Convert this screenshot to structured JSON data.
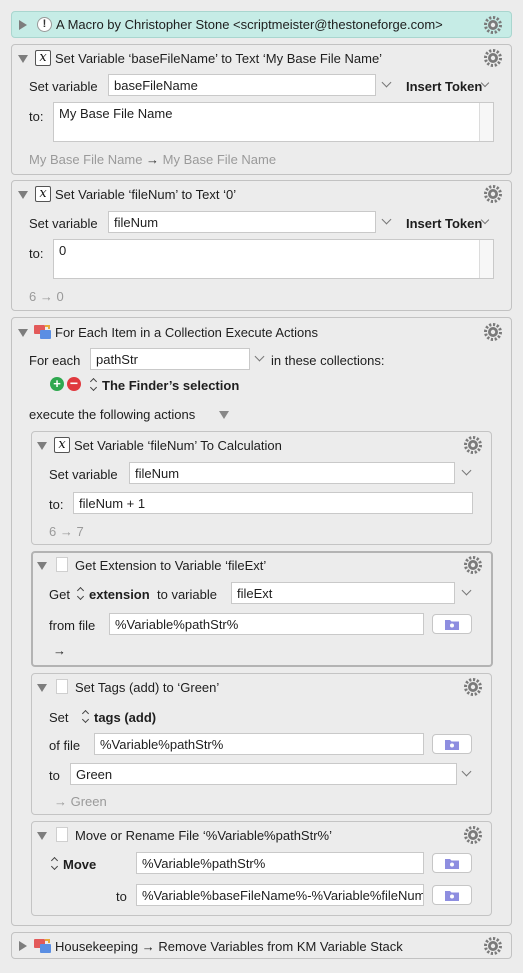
{
  "macro_header": {
    "title": "A Macro by Christopher Stone <scriptmeister@thestoneforge.com>",
    "bg": "#c6ece6"
  },
  "action1": {
    "title": "Set Variable ‘baseFileName’ to Text ‘My Base File Name’",
    "set_variable_label": "Set variable",
    "variable": "baseFileName",
    "insert_token": "Insert Token",
    "to_label": "to:",
    "value": "My Base File Name",
    "preview_left": "My Base File Name",
    "preview_arrow": "→",
    "preview_right": "My Base File Name"
  },
  "action2": {
    "title": "Set Variable ‘fileNum’ to Text ‘0’",
    "set_variable_label": "Set variable",
    "variable": "fileNum",
    "insert_token": "Insert Token",
    "to_label": "to:",
    "value": "0",
    "preview": "6 → 0"
  },
  "foreach": {
    "title": "For Each Item in a Collection Execute Actions",
    "for_each_label": "For each",
    "variable": "pathStr",
    "in_collections_label": "in these collections:",
    "collection": "The Finder’s selection",
    "execute_label": "execute the following actions",
    "sub1": {
      "title": "Set Variable ‘fileNum’ To Calculation",
      "set_variable_label": "Set variable",
      "variable": "fileNum",
      "to_label": "to:",
      "value": "fileNum + 1",
      "preview": "6 → 7"
    },
    "sub2": {
      "title": "Get Extension to Variable ‘fileExt’",
      "get_label": "Get",
      "what": "extension",
      "to_variable_label": "to variable",
      "variable": "fileExt",
      "from_file_label": "from file",
      "file": "%Variable%pathStr%",
      "preview": "→"
    },
    "sub3": {
      "title": "Set Tags (add) to ‘Green’",
      "set_label": "Set",
      "what": "tags (add)",
      "of_file_label": "of file",
      "file": "%Variable%pathStr%",
      "to_label": "to",
      "value": "Green",
      "preview": "→ Green"
    },
    "sub4": {
      "title": "Move or Rename File ‘%Variable%pathStr%’",
      "mode": "Move",
      "source": "%Variable%pathStr%",
      "to_label": "to",
      "dest": "%Variable%baseFileName%-%Variable%fileNum"
    }
  },
  "housekeeping": {
    "title": "Housekeeping → Remove Variables from KM Variable Stack"
  }
}
